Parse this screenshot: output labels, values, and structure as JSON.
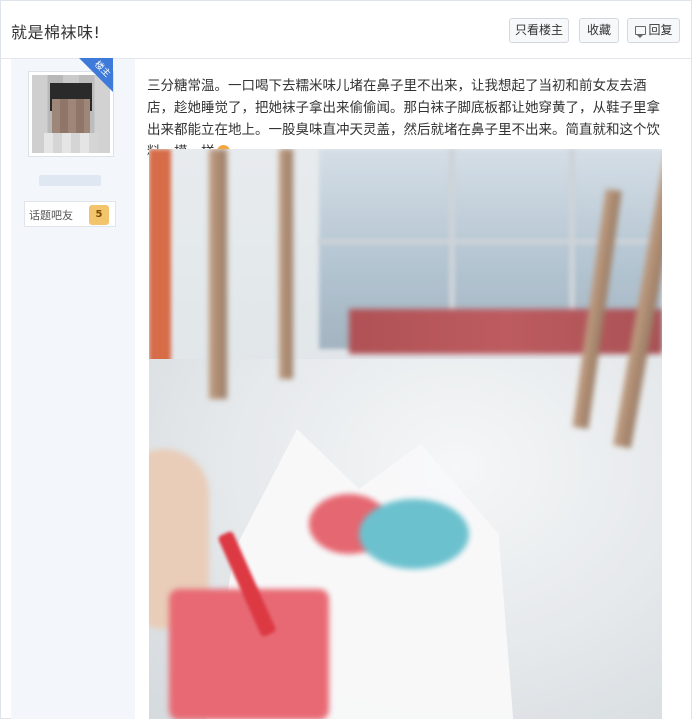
{
  "header": {
    "title": "就是棉袜味!",
    "buttons": {
      "louzhu": "只看楼主",
      "collect": "收藏",
      "reply": "回复"
    }
  },
  "sidebar": {
    "ribbon_label": "楼主",
    "badge_text": "话题吧友",
    "badge_level": "5"
  },
  "post": {
    "text": "三分糖常温。一口喝下去糯米味儿堵在鼻子里不出来，让我想起了当初和前女友去酒店，趁她睡觉了，把她袜子拿出来偷偷闻。那白袜子脚底板都让她穿黄了，从鞋子里拿出来都能立在地上。一股臭味直冲天灵盖，然后就堵在鼻子里不出来。简直就和这个饮料一模一样"
  },
  "colors": {
    "accent_blue": "#3d7ad9",
    "sidebar_bg": "#f3f6fa"
  },
  "icons": {
    "reply": "comment-icon",
    "emoji": "astonished-face-icon"
  }
}
